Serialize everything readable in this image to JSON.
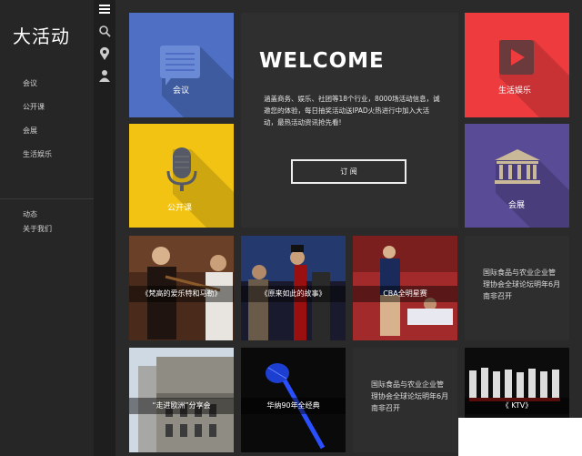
{
  "app": {
    "logo": "大活动"
  },
  "sidebar": {
    "items": [
      {
        "label": "会议"
      },
      {
        "label": "公开课"
      },
      {
        "label": "会展"
      },
      {
        "label": "生活娱乐"
      }
    ],
    "footer_items": [
      {
        "label": "动态"
      },
      {
        "label": "关于我们"
      }
    ]
  },
  "iconbar": {
    "icons": [
      "menu-icon",
      "search-icon",
      "location-icon",
      "user-icon"
    ]
  },
  "tiles": {
    "meeting": {
      "label": "会议",
      "color": "#4e6fc3"
    },
    "course": {
      "label": "公开课",
      "color": "#f2c312"
    },
    "life": {
      "label": "生活娱乐",
      "color": "#ed3b3e"
    },
    "expo": {
      "label": "会展",
      "color": "#5a4b96"
    }
  },
  "welcome": {
    "title": "WELCOME",
    "text": "涵盖商务、娱乐、社团等18个行业，8000场活动信息，诚邀您的体验，每日抽奖活动送IPAD火热进行中加入大活动，最热活动资讯抢先看!",
    "button": "订 阅"
  },
  "photos": [
    {
      "label": "《梵高的爱乐特和马勒》"
    },
    {
      "label": "《原来如此的故事》"
    },
    {
      "label": "CBA全明星赛"
    },
    {
      "label": "“走进欧洲”分享会"
    },
    {
      "label": "华纳90年全经典"
    },
    {
      "label": "《 KTV》"
    }
  ],
  "news": [
    {
      "text": "国际食品与农业企业管理协会全球论坛明年6月南非召开"
    },
    {
      "text": "国际食品与农业企业管理协会全球论坛明年6月南非召开"
    }
  ]
}
